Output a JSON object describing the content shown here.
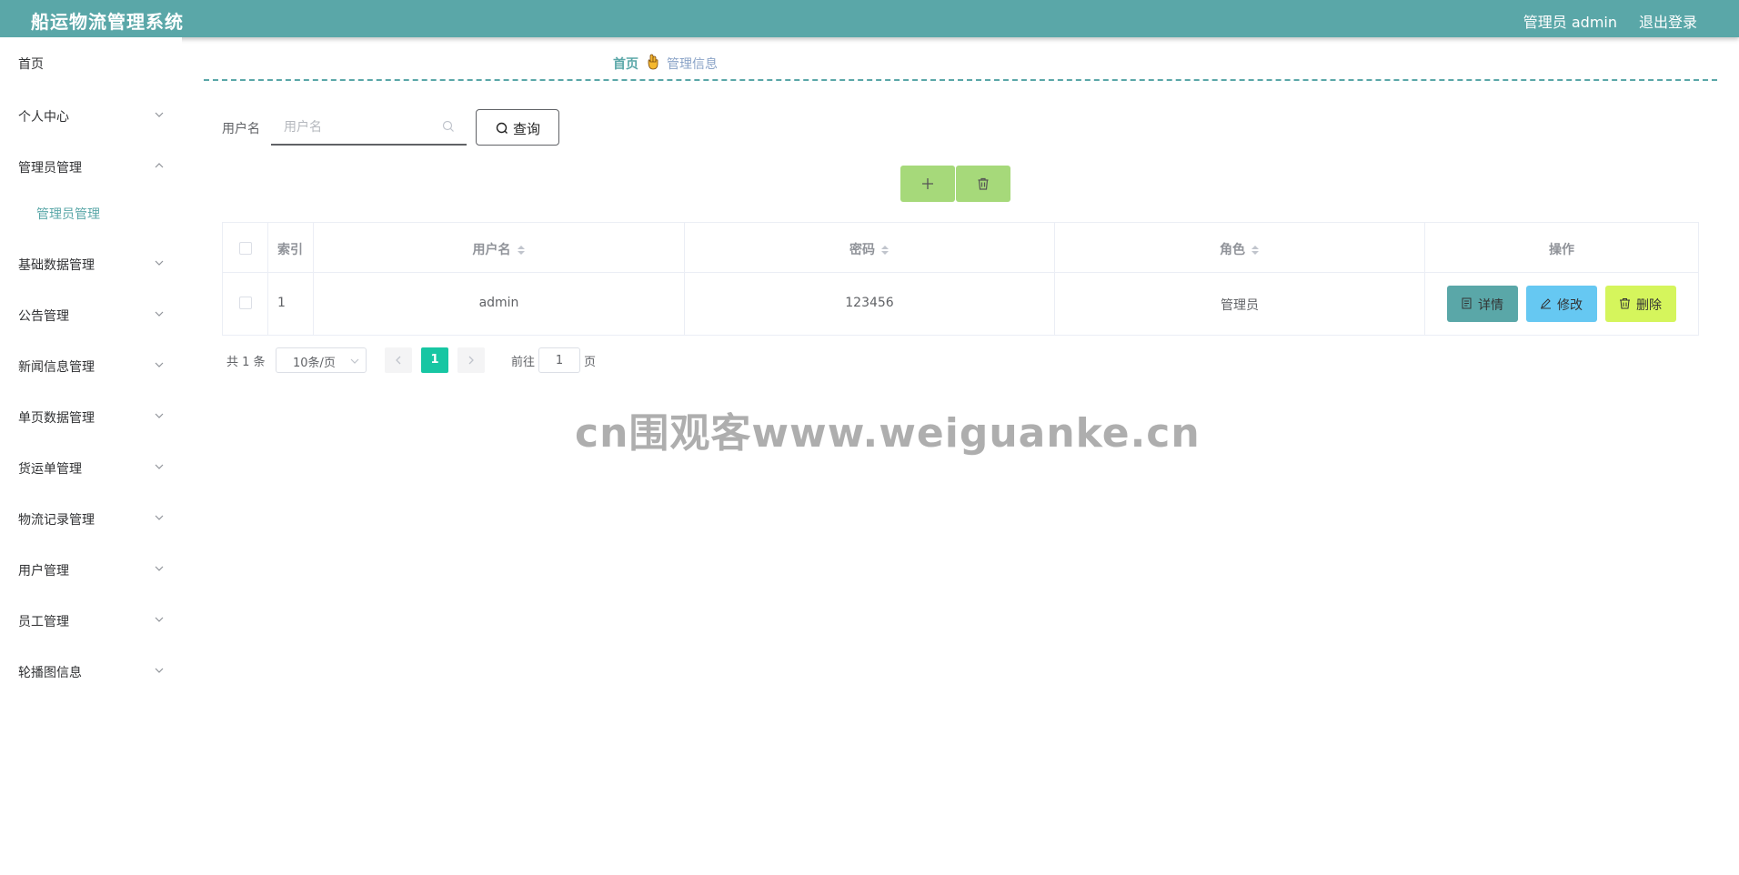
{
  "header": {
    "title": "船运物流管理系统",
    "user_label": "管理员 admin",
    "logout_label": "退出登录",
    "bg_color": "#5aa7a8"
  },
  "sidebar": {
    "items": [
      {
        "label": "首页",
        "icon": "none"
      },
      {
        "label": "个人中心",
        "icon": "chevron-down-icon"
      },
      {
        "label": "管理员管理",
        "icon": "chevron-up-icon",
        "expanded": true,
        "children": [
          {
            "label": "管理员管理"
          }
        ]
      },
      {
        "label": "基础数据管理",
        "icon": "chevron-down-icon"
      },
      {
        "label": "公告管理",
        "icon": "chevron-down-icon"
      },
      {
        "label": "新闻信息管理",
        "icon": "chevron-down-icon"
      },
      {
        "label": "单页数据管理",
        "icon": "chevron-down-icon"
      },
      {
        "label": "货运单管理",
        "icon": "chevron-down-icon"
      },
      {
        "label": "物流记录管理",
        "icon": "chevron-down-icon"
      },
      {
        "label": "用户管理",
        "icon": "chevron-down-icon"
      },
      {
        "label": "员工管理",
        "icon": "chevron-down-icon"
      },
      {
        "label": "轮播图信息",
        "icon": "chevron-down-icon"
      }
    ]
  },
  "breadcrumb": {
    "home": "首页",
    "separator_icon": "hand-icon",
    "current": "管理信息"
  },
  "search": {
    "label": "用户名",
    "placeholder": "用户名",
    "value": "",
    "button_label": "查询"
  },
  "actions": {
    "add_icon": "plus-icon",
    "delete_icon": "trash-icon",
    "color": "#a6d97a"
  },
  "table": {
    "columns": [
      "索引",
      "用户名",
      "密码",
      "角色",
      "操作"
    ],
    "rows": [
      {
        "index": "1",
        "username": "admin",
        "password": "123456",
        "role": "管理员"
      }
    ],
    "row_actions": {
      "detail": "详情",
      "edit": "修改",
      "delete": "删除"
    }
  },
  "pagination": {
    "total": "共 1 条",
    "page_size": "10条/页",
    "current_page": "1",
    "goto_label": "前往",
    "goto_value": "1",
    "page_unit": "页",
    "active_color": "#17c6a3"
  },
  "watermark": "cn围观客www.weiguanke.cn"
}
